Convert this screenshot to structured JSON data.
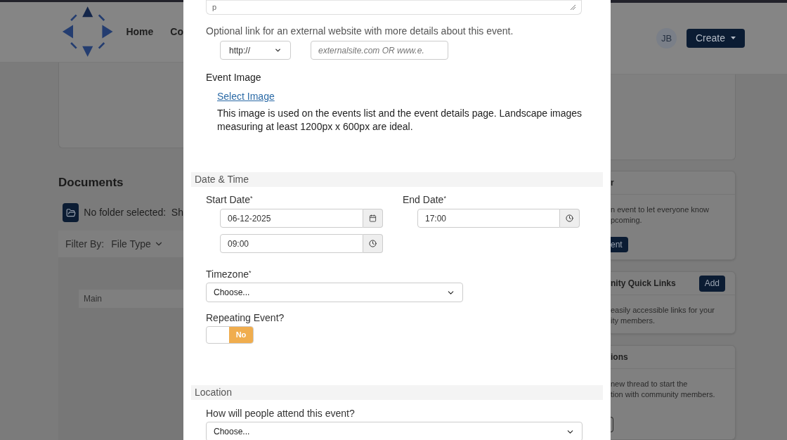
{
  "header": {
    "nav": [
      "Home",
      "Co"
    ],
    "avatar": "JB",
    "create_button": "Create"
  },
  "documents": {
    "title": "Documents",
    "folder_status": "No folder selected:  Sh",
    "filter_label": "Filter By:",
    "filter_value": "File Type",
    "folder_item": "Main"
  },
  "side_cards": [
    {
      "kind": "body_button",
      "title": "r",
      "lines": [
        "n event to let everyone know",
        "pcoming."
      ],
      "button": "ent"
    },
    {
      "kind": "header_button",
      "title": "nity Quick Links",
      "button": "Add",
      "lines": [
        "easily accessible links for your",
        "ity members."
      ]
    },
    {
      "kind": "outline_button",
      "title": "ions",
      "lines": [
        "new thread to start the",
        "tion with community members."
      ]
    }
  ],
  "modal": {
    "description_footer": "p",
    "external_link": {
      "hint": "Optional link for an external website with more details about this event.",
      "protocol": "http://",
      "url_placeholder": "externalsite.com OR www.e."
    },
    "event_image": {
      "label": "Event Image",
      "link": "Select Image",
      "help": "This image is used on the events list and the event details page. Landscape images measuring at least 1200px x 600px are ideal."
    },
    "date_time": {
      "title": "Date & Time",
      "start_label": "Start Date$^{*}$",
      "start_date": "06-12-2025",
      "start_time": "09:00",
      "end_label": "End Date$^{*}$",
      "end_time": "17:00",
      "timezone_label": "Timezone$^{*}$",
      "timezone_value": "Choose...",
      "repeating_label": "Repeating Event?",
      "repeating": {
        "on": false,
        "text": "No"
      }
    },
    "location": {
      "title": "Location",
      "attend_label": "How will people attend this event?",
      "attend_value": "Choose..."
    }
  }
}
